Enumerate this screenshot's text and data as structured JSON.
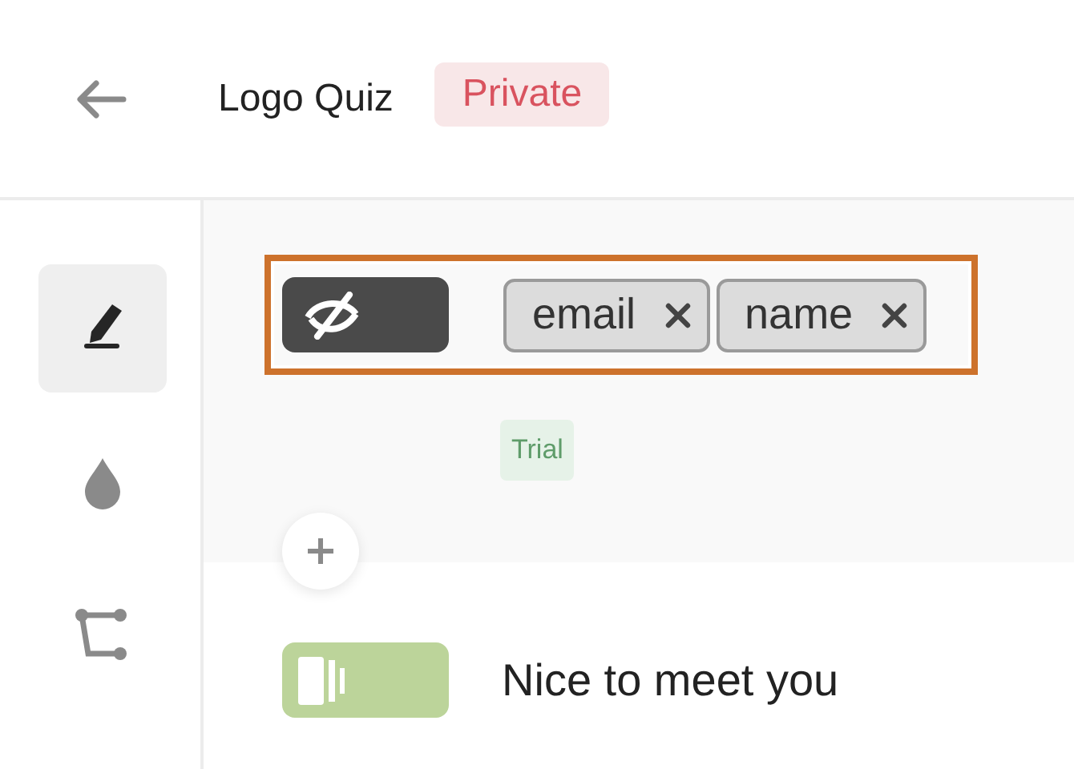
{
  "header": {
    "title": "Logo Quiz",
    "badge": "Private"
  },
  "sidebar": {
    "items": [
      {
        "kind": "pen",
        "selected": true
      },
      {
        "kind": "drop",
        "selected": false
      },
      {
        "kind": "route",
        "selected": false
      }
    ]
  },
  "blocks": [
    {
      "kind": "hidden-fields",
      "selected": true,
      "tags": [
        "email",
        "name"
      ],
      "badge": "Trial"
    },
    {
      "kind": "message",
      "selected": false,
      "text": "Nice to meet you"
    }
  ]
}
